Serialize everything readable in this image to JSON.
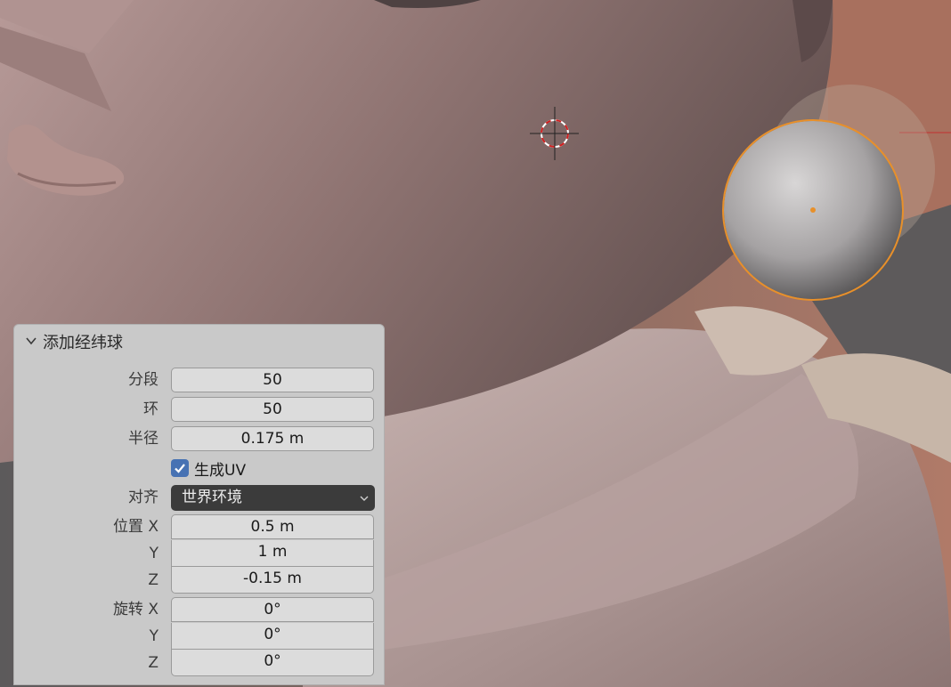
{
  "panel": {
    "title": "添加经纬球",
    "segments": {
      "label": "分段",
      "value": "50"
    },
    "rings": {
      "label": "环",
      "value": "50"
    },
    "radius": {
      "label": "半径",
      "value": "0.175 m"
    },
    "generate_uv": {
      "label": "生成UV",
      "checked": true
    },
    "align": {
      "label": "对齐",
      "value": "世界环境"
    },
    "location": {
      "label_x": "位置 X",
      "label_y": "Y",
      "label_z": "Z",
      "x": "0.5 m",
      "y": "1 m",
      "z": "-0.15 m"
    },
    "rotation": {
      "label_x": "旋转 X",
      "label_y": "Y",
      "label_z": "Z",
      "x": "0°",
      "y": "0°",
      "z": "0°"
    }
  },
  "colors": {
    "accent": "#4772b3",
    "selection_outline": "#e8902a",
    "dropdown_bg": "#3b3b3b"
  }
}
